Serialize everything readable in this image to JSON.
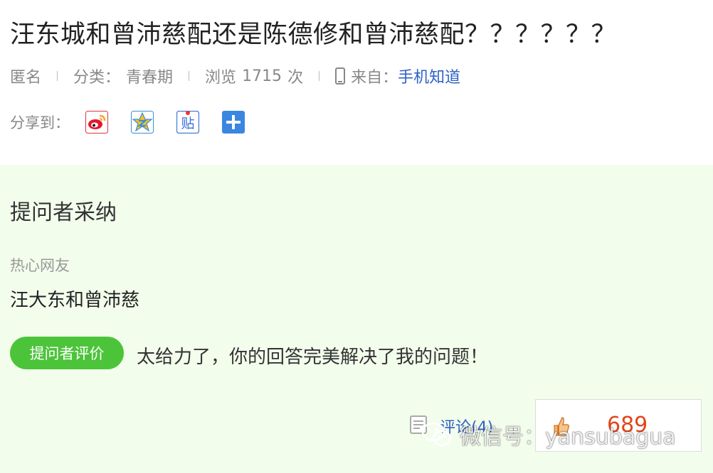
{
  "question": {
    "title": "汪东城和曾沛慈配还是陈德修和曾沛慈配？？？？？？",
    "meta": {
      "author": "匿名",
      "category_label": "分类：",
      "category_value": "青春期",
      "views_label": "浏览",
      "views_count": "1715",
      "views_unit": "次",
      "source_label": "来自：",
      "source_value": "手机知道"
    }
  },
  "share": {
    "label": "分享到：",
    "icons": [
      "weibo-icon",
      "qzone-icon",
      "tieba-icon",
      "more-share-icon"
    ],
    "tieba_glyph": "贴"
  },
  "adopted": {
    "heading": "提问者采纳",
    "author": "热心网友",
    "answer": "汪大东和曾沛慈",
    "badge": "提问者评价",
    "evaluation": "太给力了，你的回答完美解决了我的问题！"
  },
  "actions": {
    "comment_label": "评论(4)",
    "like_count": "689"
  },
  "watermark": {
    "text": "微信号：yansubagua"
  },
  "colors": {
    "link": "#2e62c6",
    "panel_bg": "#f3fdec",
    "badge_bg": "#4cc43a",
    "like_count": "#e0461c"
  }
}
